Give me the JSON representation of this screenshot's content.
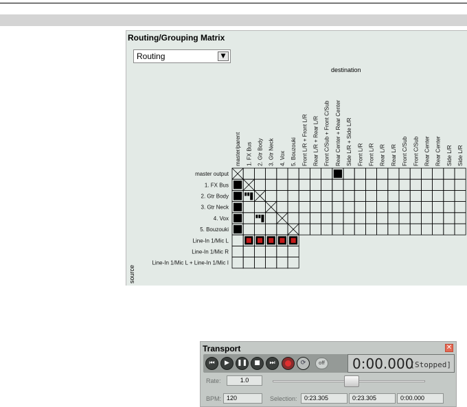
{
  "routing_matrix": {
    "title": "Routing/Grouping Matrix",
    "mode_dropdown": {
      "value": "Routing"
    },
    "destination_label": "destination",
    "source_label": "source",
    "destinations": [
      "master/parent",
      "1. FX Bus",
      "2. Gtr Body",
      "3. Gtr Neck",
      "4. Vox",
      "5. Bouzouki",
      "Front L/R + Front L/R",
      "Rear L/R + Rear L/R",
      "Front C/Sub + Front C/Sub",
      "Rear Center + Rear Center",
      "Side L/R + Side L/R",
      "Front L/R",
      "Front L/R",
      "Rear L/R",
      "Rear L/R",
      "Front C/Sub",
      "Front C/Sub",
      "Rear Center",
      "Rear Center",
      "Side L/R",
      "Side L/R"
    ],
    "track_rows": [
      "master output",
      "1. FX Bus",
      "2. Gtr Body",
      "3. Gtr Neck",
      "4. Vox",
      "5. Bouzouki"
    ],
    "input_rows": [
      "Line-In 1/Mic L",
      "Line-In 1/Mic R",
      "Line-In 1/Mic L + Line-In 1/Mic I"
    ],
    "track_cells": [
      {
        "row": 0,
        "col": 0,
        "state": "self"
      },
      {
        "row": 0,
        "col": 9,
        "state": "routed"
      },
      {
        "row": 1,
        "col": 0,
        "state": "routed"
      },
      {
        "row": 1,
        "col": 1,
        "state": "self"
      },
      {
        "row": 2,
        "col": 0,
        "state": "routed"
      },
      {
        "row": 2,
        "col": 1,
        "state": "send"
      },
      {
        "row": 2,
        "col": 2,
        "state": "self"
      },
      {
        "row": 3,
        "col": 0,
        "state": "routed"
      },
      {
        "row": 3,
        "col": 3,
        "state": "self"
      },
      {
        "row": 4,
        "col": 0,
        "state": "routed"
      },
      {
        "row": 4,
        "col": 2,
        "state": "send"
      },
      {
        "row": 4,
        "col": 4,
        "state": "self"
      },
      {
        "row": 5,
        "col": 0,
        "state": "routed"
      },
      {
        "row": 5,
        "col": 5,
        "state": "self"
      }
    ],
    "input_cells": [
      {
        "row": 0,
        "col": 1,
        "state": "record"
      },
      {
        "row": 0,
        "col": 2,
        "state": "record"
      },
      {
        "row": 0,
        "col": 3,
        "state": "record"
      },
      {
        "row": 0,
        "col": 4,
        "state": "record"
      },
      {
        "row": 0,
        "col": 5,
        "state": "record"
      }
    ],
    "colors": {
      "routed": "#000000",
      "record_fill": "#c41b1b",
      "grid": "#000000",
      "background": "#e3eae6"
    }
  },
  "transport": {
    "title": "Transport",
    "close_icon": "close-icon",
    "buttons": [
      {
        "name": "go-to-start-button",
        "icon": "skip-back-icon",
        "glyph": "⏮"
      },
      {
        "name": "play-button",
        "icon": "play-icon",
        "glyph": "▶"
      },
      {
        "name": "pause-button",
        "icon": "pause-icon",
        "glyph": "❚❚"
      },
      {
        "name": "stop-button",
        "icon": "stop-icon",
        "glyph": "■"
      },
      {
        "name": "go-to-end-button",
        "icon": "skip-forward-icon",
        "glyph": "⏭"
      }
    ],
    "record_button": {
      "icon": "record-icon"
    },
    "loop_button": {
      "icon": "loop-icon",
      "glyph": "⟳"
    },
    "off_button_label": "off",
    "time": "0:00.000",
    "status": "[Stopped]",
    "rate_label": "Rate:",
    "rate_value": "1.0",
    "rate_slider_position": 0.52,
    "bpm_label": "BPM:",
    "bpm_value": "120",
    "selection_label": "Selection:",
    "selection_start": "0:23.305",
    "selection_end": "0:23.305",
    "selection_length": "0:00.000"
  }
}
